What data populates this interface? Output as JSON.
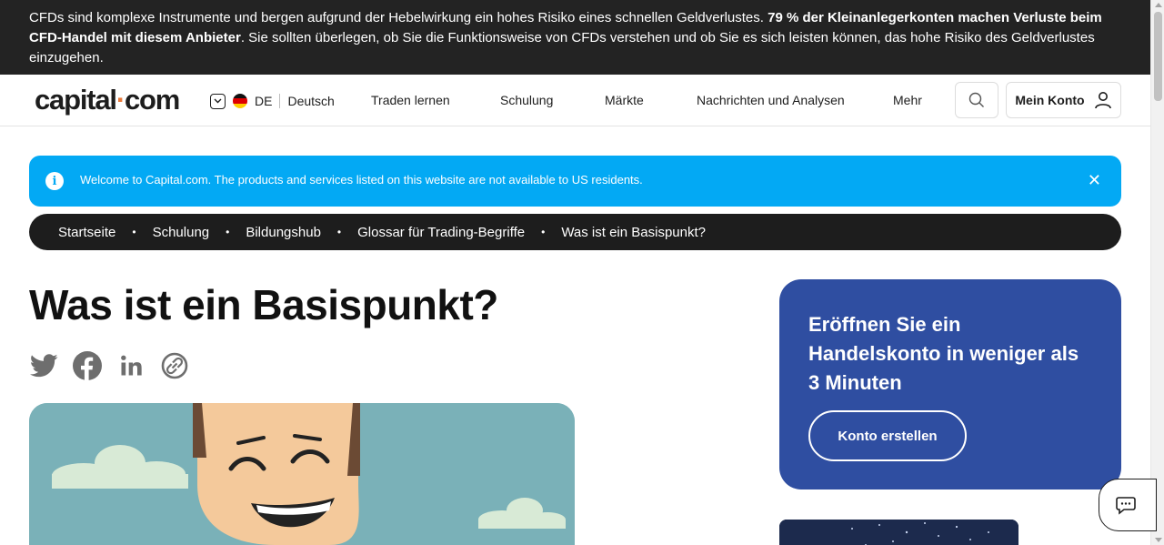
{
  "risk_warning": {
    "part1": "CFDs sind komplexe Instrumente und bergen aufgrund der Hebelwirkung ein hohes Risiko eines schnellen Geldverlustes. ",
    "bold": "79 % der Kleinanlegerkonten machen Verluste beim CFD-Handel mit diesem Anbieter",
    "part2": ". Sie sollten überlegen, ob Sie die Funktionsweise von CFDs verstehen und ob Sie es sich leisten können, das hohe Risiko des Geldverlustes einzugehen."
  },
  "header": {
    "logo_left": "capital",
    "logo_dot": "·",
    "logo_right": "com",
    "lang_code": "DE",
    "lang_name": "Deutsch",
    "nav": [
      "Traden lernen",
      "Schulung",
      "Märkte",
      "Nachrichten und Analysen",
      "Mehr"
    ],
    "account_label": "Mein Konto"
  },
  "notice": {
    "text": "Welcome to Capital.com. The products and services listed on this website are not available to US residents.",
    "close": "✕"
  },
  "breadcrumb": [
    "Startseite",
    "Schulung",
    "Bildungshub",
    "Glossar für Trading-Begriffe",
    "Was ist ein Basispunkt?"
  ],
  "page_title": "Was ist ein Basispunkt?",
  "share_icons": [
    "twitter-icon",
    "facebook-icon",
    "linkedin-icon",
    "copy-link-icon"
  ],
  "cta": {
    "heading": "Eröffnen Sie ein Handelskonto in weniger als 3 Minuten",
    "button": "Konto erstellen"
  },
  "colors": {
    "risk_bg": "#232323",
    "notice_bg": "#03a9f4",
    "breadcrumb_bg": "#1d1d1d",
    "cta_bg": "#2f4ea1",
    "logo_dot": "#e97a3b"
  }
}
